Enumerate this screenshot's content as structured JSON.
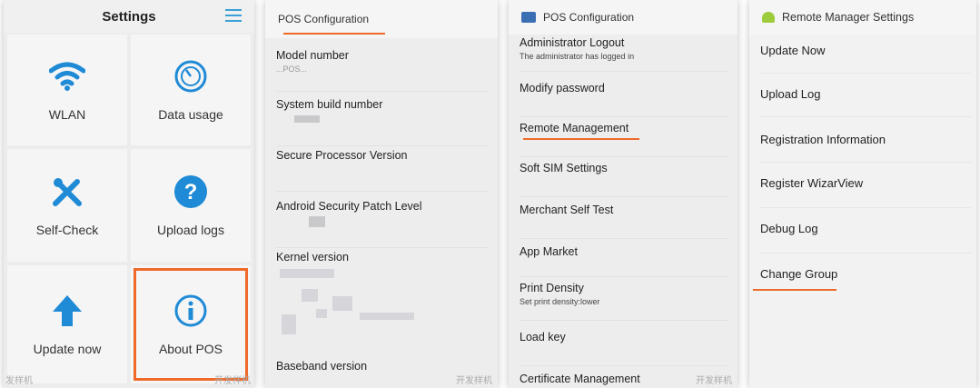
{
  "panel1": {
    "title": "Settings",
    "tiles": [
      {
        "label": "WLAN",
        "icon": "wifi-icon"
      },
      {
        "label": "Data usage",
        "icon": "gauge-icon"
      },
      {
        "label": "Self-Check",
        "icon": "tools-icon"
      },
      {
        "label": "Upload logs",
        "icon": "question-icon"
      },
      {
        "label": "Update now",
        "icon": "arrow-up-icon"
      },
      {
        "label": "About POS",
        "icon": "info-icon"
      }
    ],
    "watermark_left": "发样机",
    "watermark_right": "开发样机"
  },
  "panel2": {
    "title": "POS Configuration",
    "items": [
      {
        "label": "Model number",
        "value": "...POS..."
      },
      {
        "label": "System build number"
      },
      {
        "label": "Secure Processor Version"
      },
      {
        "label": "Android Security Patch Level"
      },
      {
        "label": "Kernel version"
      },
      {
        "label": "Baseband version"
      }
    ],
    "watermark": "开发样机"
  },
  "panel3": {
    "title": "POS Configuration",
    "items": [
      {
        "label": "Administrator Logout",
        "sub": "The administrator has logged in"
      },
      {
        "label": "Modify password"
      },
      {
        "label": "Remote Management"
      },
      {
        "label": "Soft SIM Settings"
      },
      {
        "label": "Merchant Self Test"
      },
      {
        "label": "App Market"
      },
      {
        "label": "Print Density",
        "sub": "Set print density:lower"
      },
      {
        "label": "Load key"
      },
      {
        "label": "Certificate Management"
      }
    ],
    "watermark": "开发样机"
  },
  "panel4": {
    "title": "Remote Manager Settings",
    "items": [
      "Update Now",
      "Upload Log",
      "Registration Information",
      "Register WizarView",
      "Debug Log",
      "Change Group"
    ]
  },
  "colors": {
    "accent": "#ef6a2a",
    "icon_blue": "#1f8ad6"
  }
}
